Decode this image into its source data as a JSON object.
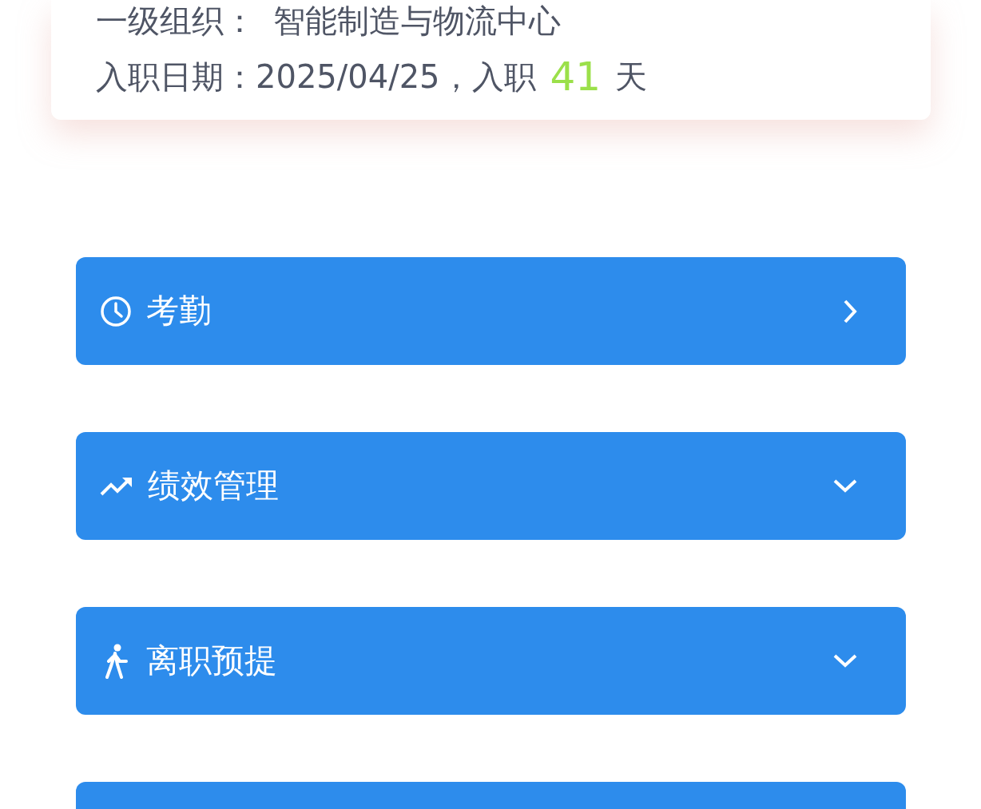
{
  "profile_card": {
    "org_label": "一级组织：",
    "org_value": "智能制造与物流中心",
    "date_label": "入职日期：",
    "date_value": "2025/04/25，入职",
    "days": "41",
    "days_unit": "天"
  },
  "menu": [
    {
      "kind": "link",
      "label": "考勤"
    },
    {
      "kind": "collapsible",
      "label": "绩效管理",
      "expanded": false
    },
    {
      "kind": "collapsible",
      "label": "离职预提",
      "expanded": false
    },
    {
      "kind": "cut"
    }
  ]
}
